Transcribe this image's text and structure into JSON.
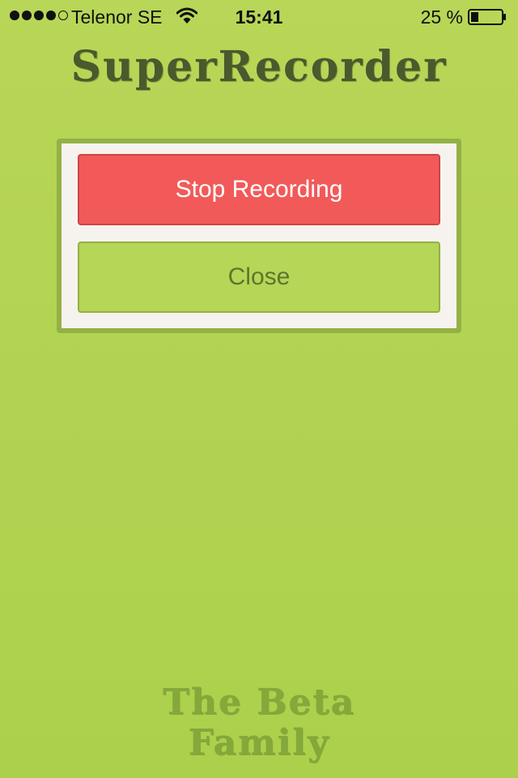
{
  "status_bar": {
    "carrier": "Telenor SE",
    "time": "15:41",
    "battery_percent": "25 %",
    "signal_bars_filled": 4,
    "signal_bars_total": 5,
    "battery_level": 0.25,
    "icons": [
      "wifi-icon",
      "battery-icon"
    ]
  },
  "app": {
    "title": "SuperRecorder"
  },
  "dialog": {
    "stop_label": "Stop Recording",
    "close_label": "Close"
  },
  "footer": {
    "line1": "The Beta",
    "line2": "Family"
  },
  "colors": {
    "background": "#b8d657",
    "stop_button": "#f15a59",
    "close_button": "#b6d657",
    "card": "#f6f3ee",
    "card_border": "#93b145"
  }
}
